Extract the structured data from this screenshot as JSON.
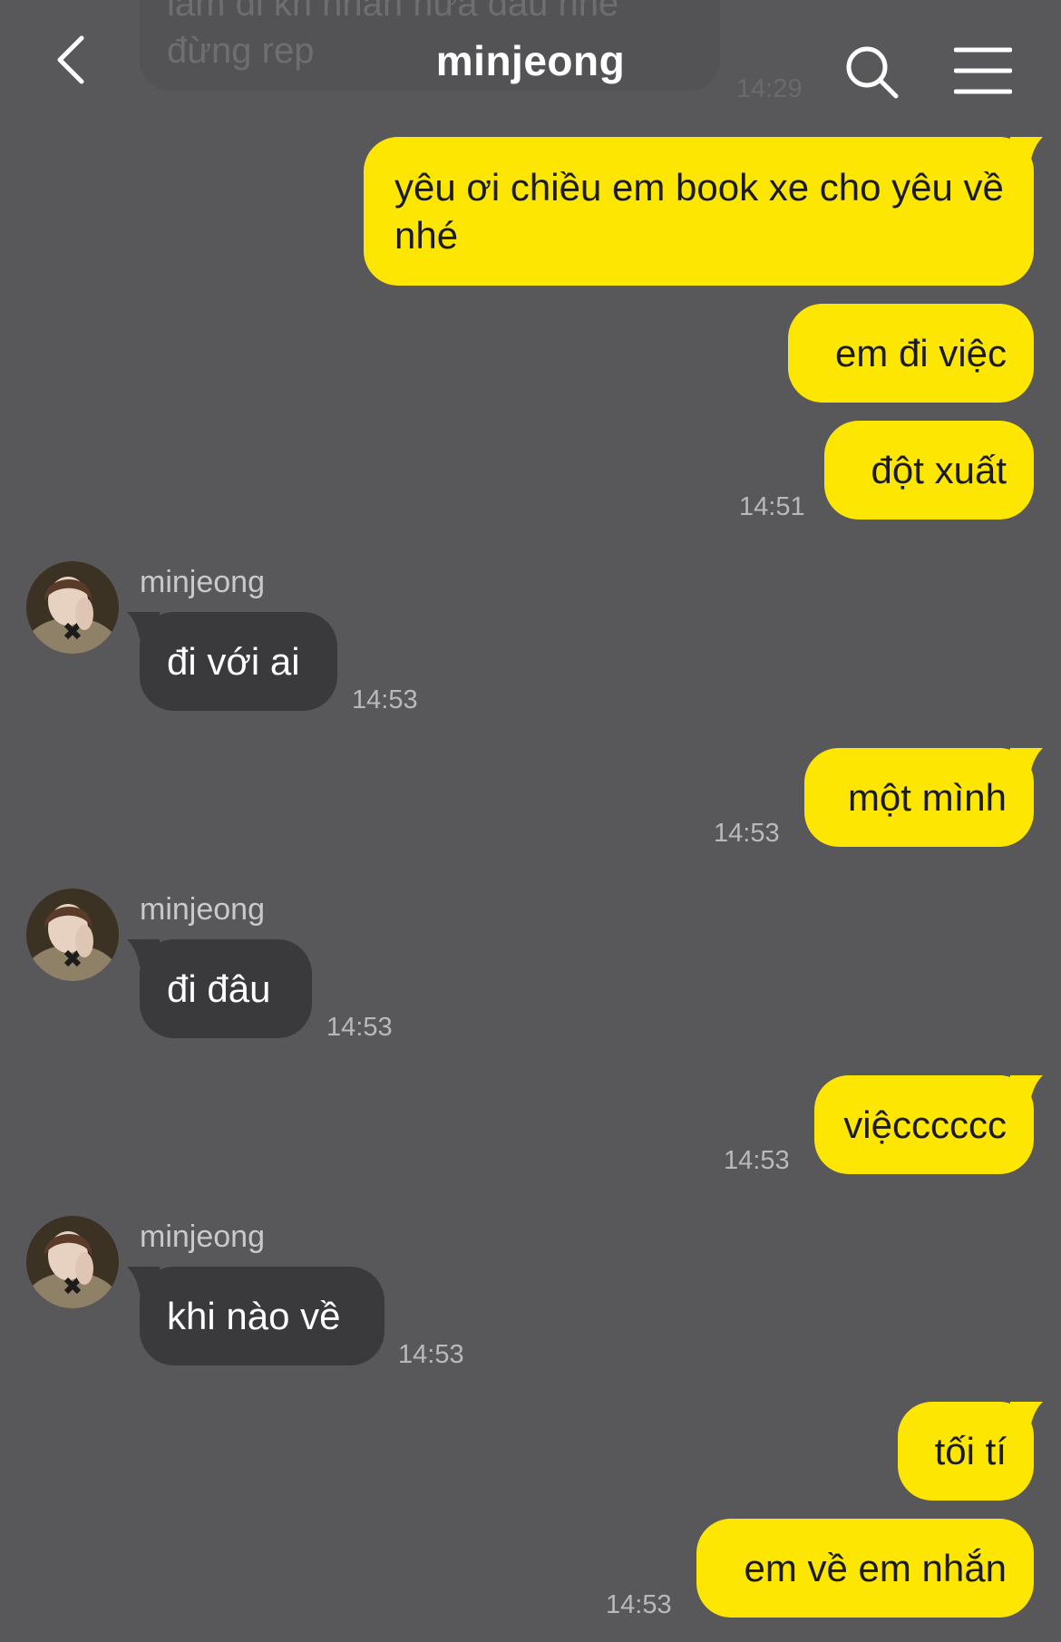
{
  "header": {
    "title": "minjeong",
    "back_icon": "back-chevron-icon",
    "search_icon": "search-icon",
    "menu_icon": "hamburger-menu-icon"
  },
  "previous_message": {
    "text": "làm đi kh nhắn nữa đâu nhé đừng rep",
    "time": "14:29"
  },
  "colors": {
    "background": "#58575a",
    "my_bubble": "#fde602",
    "their_bubble": "#3a393c"
  },
  "messages": [
    {
      "from": "me",
      "text": "yêu ơi chiều em book xe cho yêu về nhé"
    },
    {
      "from": "me",
      "text": "em đi việc"
    },
    {
      "from": "me",
      "text": "đột xuất",
      "time": "14:51"
    },
    {
      "from": "them",
      "sender": "minjeong",
      "text": "đi với ai",
      "time": "14:53"
    },
    {
      "from": "me",
      "text": "một mình",
      "time": "14:53"
    },
    {
      "from": "them",
      "sender": "minjeong",
      "text": "đi đâu",
      "time": "14:53"
    },
    {
      "from": "me",
      "text": "việcccccc",
      "time": "14:53"
    },
    {
      "from": "them",
      "sender": "minjeong",
      "text": "khi nào về",
      "time": "14:53"
    },
    {
      "from": "me",
      "text": "tối tí"
    },
    {
      "from": "me",
      "text": "em về em nhắn",
      "time": "14:53"
    }
  ]
}
